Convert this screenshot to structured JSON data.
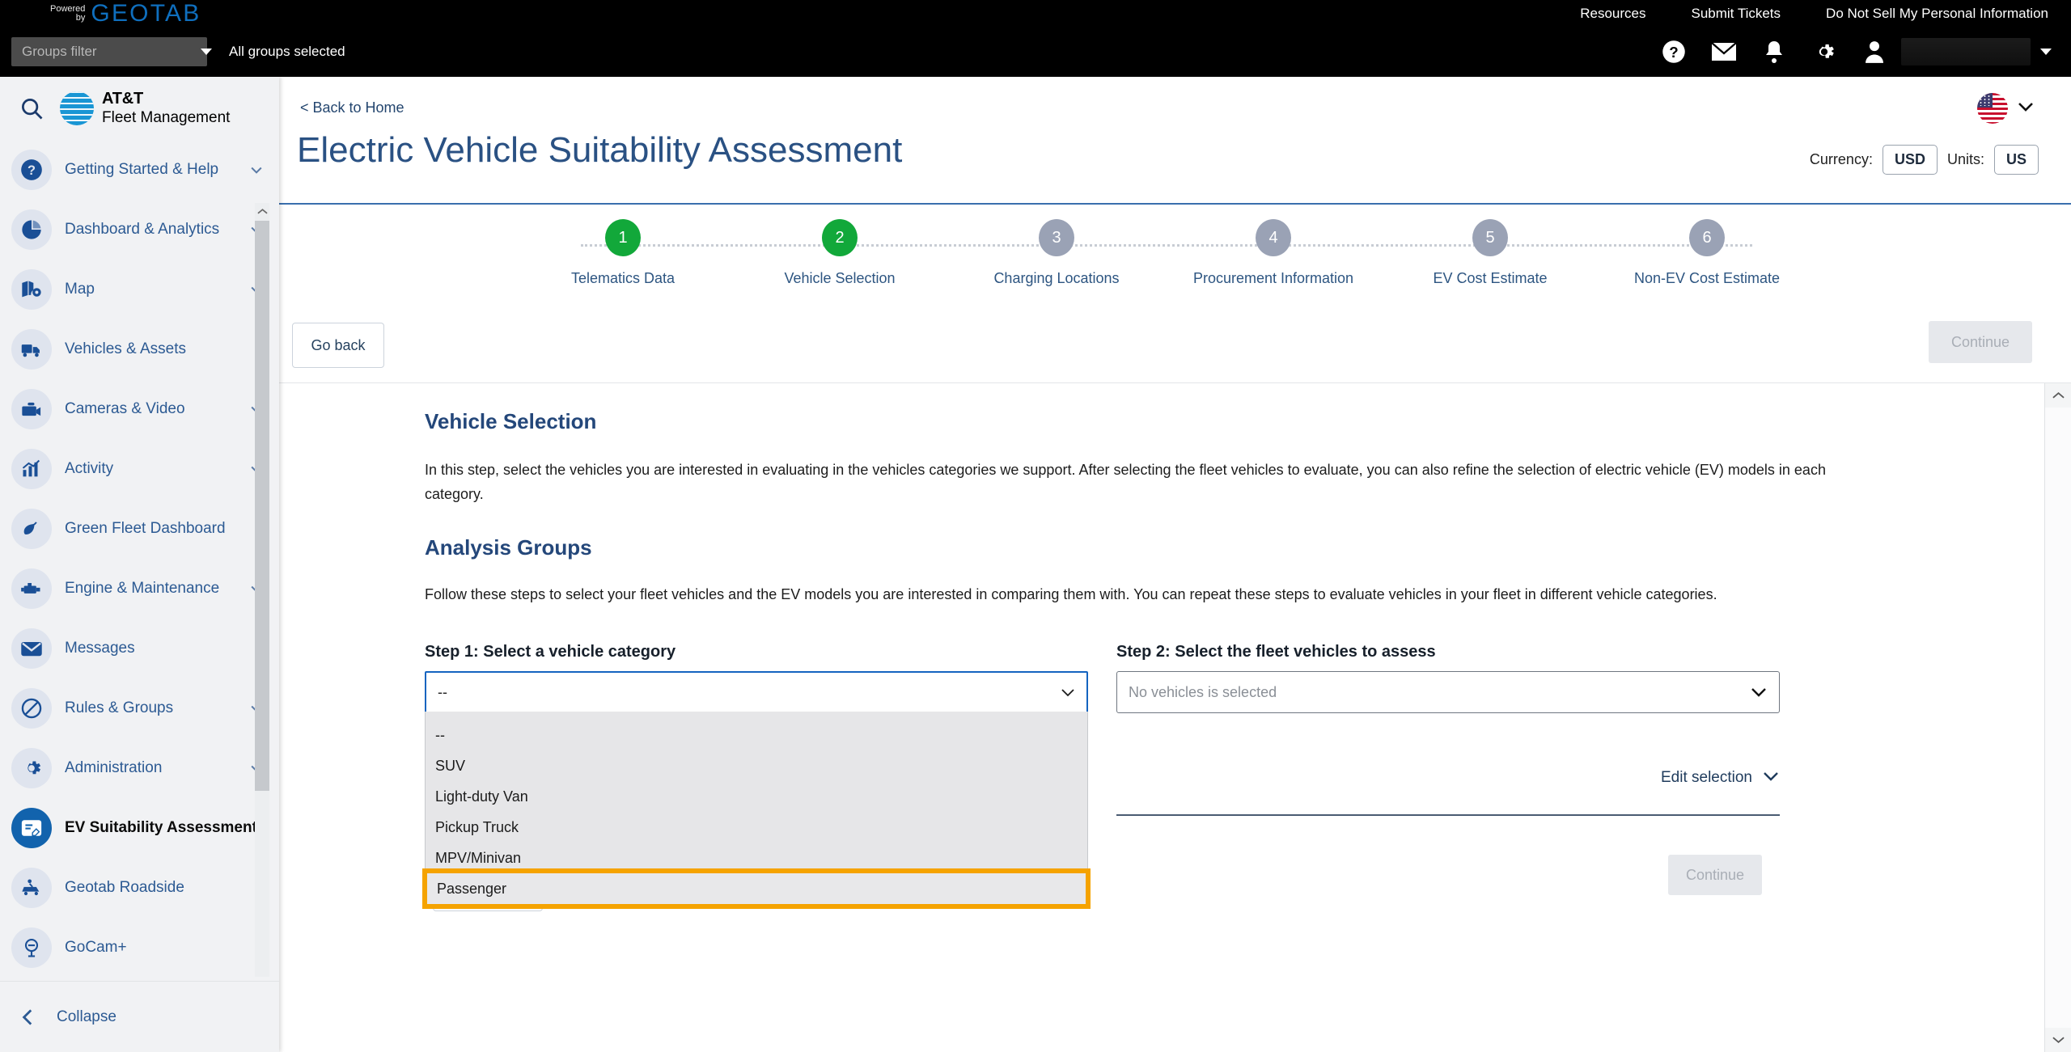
{
  "topbar": {
    "logo_powered": "Powered",
    "logo_by": "by",
    "logo_brand": "GEOTAB",
    "links": [
      {
        "label": "Resources",
        "name": "resources"
      },
      {
        "label": "Submit Tickets",
        "name": "submit-tickets"
      },
      {
        "label": "Do Not Sell My Personal Information",
        "name": "do-not-sell"
      }
    ]
  },
  "subbar": {
    "groups_filter_placeholder": "Groups filter",
    "groups_filter_value": "",
    "all_groups_label": "All groups selected",
    "icons": [
      "help-icon",
      "mail-icon",
      "bell-icon",
      "gear-icon",
      "user-icon"
    ],
    "user_name": ""
  },
  "sidebar": {
    "brand_line1": "AT&T",
    "brand_line2": "Fleet Management",
    "search_label": "Search",
    "items": [
      {
        "label": "Getting Started & Help",
        "icon": "question-circle-icon",
        "chevron": true,
        "active": false
      },
      {
        "label": "Dashboard & Analytics",
        "icon": "pie-chart-icon",
        "chevron": true,
        "active": false
      },
      {
        "label": "Map",
        "icon": "map-pin-icon",
        "chevron": true,
        "active": false
      },
      {
        "label": "Vehicles & Assets",
        "icon": "truck-icon",
        "chevron": false,
        "active": false
      },
      {
        "label": "Cameras & Video",
        "icon": "camera-icon",
        "chevron": true,
        "active": false
      },
      {
        "label": "Activity",
        "icon": "bar-chart-icon",
        "chevron": true,
        "active": false
      },
      {
        "label": "Green Fleet Dashboard",
        "icon": "leaf-icon",
        "chevron": false,
        "active": false
      },
      {
        "label": "Engine & Maintenance",
        "icon": "engine-icon",
        "chevron": true,
        "active": false
      },
      {
        "label": "Messages",
        "icon": "envelope-icon",
        "chevron": false,
        "active": false
      },
      {
        "label": "Rules & Groups",
        "icon": "no-entry-icon",
        "chevron": true,
        "active": false
      },
      {
        "label": "Administration",
        "icon": "cog-icon",
        "chevron": true,
        "active": false
      },
      {
        "label": "EV Suitability Assessment",
        "icon": "ev-assessment-icon",
        "chevron": false,
        "active": true
      },
      {
        "label": "Geotab Roadside",
        "icon": "roadside-icon",
        "chevron": false,
        "active": false
      },
      {
        "label": "GoCam+",
        "icon": "gocam-icon",
        "chevron": false,
        "active": false
      }
    ],
    "collapse_label": "Collapse",
    "collapse_icon": "chevron-left-icon"
  },
  "main": {
    "back_link": "< Back to Home",
    "title": "Electric Vehicle Suitability Assessment",
    "locale_flag": "us-flag-icon",
    "currency_label": "Currency:",
    "currency_value": "USD",
    "units_label": "Units:",
    "units_value": "US"
  },
  "stepper": {
    "steps": [
      {
        "number": "1",
        "label": "Telematics Data",
        "state": "done"
      },
      {
        "number": "2",
        "label": "Vehicle Selection",
        "state": "done"
      },
      {
        "number": "3",
        "label": "Charging Locations",
        "state": "pending"
      },
      {
        "number": "4",
        "label": "Procurement Information",
        "state": "pending"
      },
      {
        "number": "5",
        "label": "EV Cost Estimate",
        "state": "pending"
      },
      {
        "number": "6",
        "label": "Non-EV Cost Estimate",
        "state": "pending"
      }
    ]
  },
  "actions": {
    "go_back": "Go back",
    "continue_top": "Continue",
    "continue_bottom": "Continue"
  },
  "content": {
    "section1_title": "Vehicle Selection",
    "section1_body": "In this step, select the vehicles you are interested in evaluating in the vehicles categories we support. After selecting the fleet vehicles to evaluate, you can also refine the selection of electric vehicle (EV) models in each category.",
    "section2_title": "Analysis Groups",
    "section2_body": "Follow these steps to select your fleet vehicles and the EV models you are interested in comparing them with. You can repeat these steps to evaluate vehicles in your fleet in different vehicle categories.",
    "step1": {
      "label": "Step 1: Select a vehicle category",
      "selected_value": "--",
      "open": true,
      "options": [
        {
          "label": "--",
          "selected": false
        },
        {
          "label": "SUV",
          "selected": false
        },
        {
          "label": "Light-duty Van",
          "selected": false
        },
        {
          "label": "Pickup Truck",
          "selected": false
        },
        {
          "label": "MPV/Minivan",
          "selected": false
        },
        {
          "label": "Passenger",
          "selected": true
        }
      ]
    },
    "step2": {
      "label": "Step 2: Select the fleet vehicles to assess",
      "placeholder": "No vehicles is selected",
      "value": ""
    },
    "edit_selection": "Edit selection"
  },
  "colors": {
    "accent_blue": "#2a5183",
    "step_done_green": "#12a83a",
    "step_pending_gray": "#9aa2b5",
    "highlight_orange": "#f5a300",
    "focus_blue": "#1464c0",
    "brand_geotab_blue": "#0f6fbe",
    "att_blue": "#1996d4"
  }
}
